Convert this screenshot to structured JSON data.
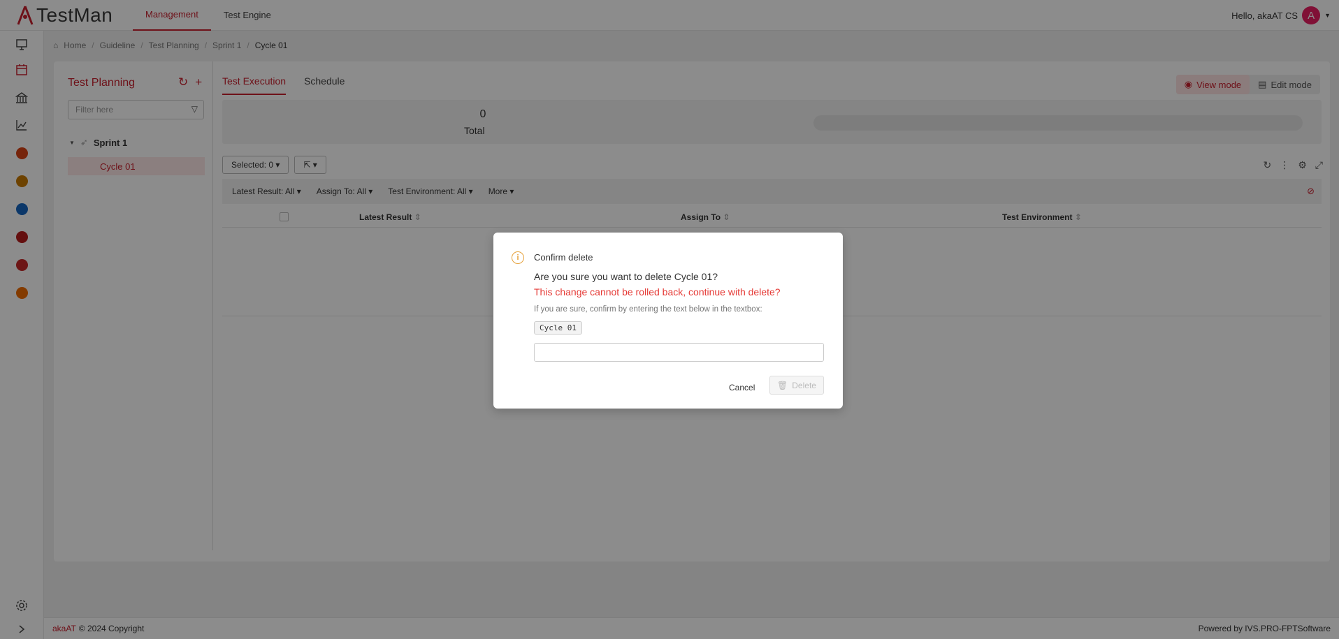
{
  "app": {
    "name": "TestMan"
  },
  "topnav": {
    "items": [
      {
        "label": "Management"
      },
      {
        "label": "Test Engine"
      }
    ]
  },
  "user": {
    "greeting": "Hello, akaAT CS",
    "avatar_initial": "A"
  },
  "breadcrumb": [
    "Home",
    "Guideline",
    "Test Planning",
    "Sprint 1",
    "Cycle 01"
  ],
  "left_pane": {
    "title": "Test Planning",
    "filter_placeholder": "Filter here",
    "tree": {
      "sprint": "Sprint 1",
      "cycle": "Cycle 01"
    }
  },
  "tabs": [
    {
      "label": "Test Execution"
    },
    {
      "label": "Schedule"
    }
  ],
  "modes": {
    "view": "View mode",
    "edit": "Edit mode"
  },
  "summary": {
    "total_value": "0",
    "total_label": "Total"
  },
  "toolbar": {
    "selected": "Selected: 0"
  },
  "filters": [
    "Latest Result: All",
    "Assign To: All",
    "Test Environment: All",
    "More"
  ],
  "columns": [
    "Latest Result",
    "Assign To",
    "Test Environment"
  ],
  "footer": {
    "brand": "akaAT",
    "copyright": "© 2024 Copyright",
    "powered": "Powered by IVS.PRO-FPTSoftware"
  },
  "modal": {
    "title": "Confirm delete",
    "question": "Are you sure you want to delete Cycle 01?",
    "warning": "This change cannot be rolled back, continue with delete?",
    "hint": "If you are sure, confirm by entering the text below in the textbox:",
    "code": "Cycle 01",
    "cancel": "Cancel",
    "delete": "Delete"
  },
  "colors": {
    "accent": "#c8202e",
    "warning": "#e53935",
    "info_icon": "#e6a23c"
  }
}
